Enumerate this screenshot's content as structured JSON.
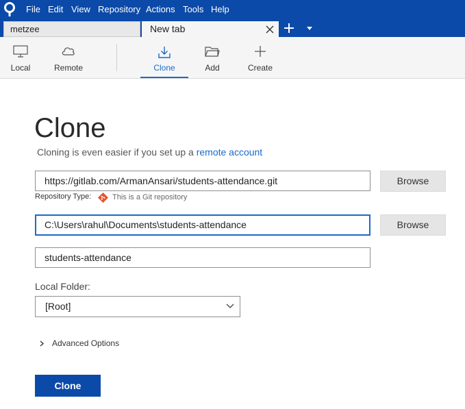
{
  "menu": {
    "items": [
      "File",
      "Edit",
      "View",
      "Repository",
      "Actions",
      "Tools",
      "Help"
    ]
  },
  "tabs": [
    {
      "label": "metzee",
      "active": false
    },
    {
      "label": "New tab",
      "active": true
    }
  ],
  "toolbar": {
    "local": "Local",
    "remote": "Remote",
    "clone": "Clone",
    "add": "Add",
    "create": "Create"
  },
  "clone_page": {
    "title": "Clone",
    "subtitle_prefix": "Cloning is even easier if you set up a ",
    "subtitle_link": "remote account",
    "source_url": "https://gitlab.com/ArmanAnsari/students-attendance.git",
    "repo_type_label": "Repository Type:",
    "repo_type_value": "This is a Git repository",
    "destination_path": "C:\\Users\\rahul\\Documents\\students-attendance",
    "name": "students-attendance",
    "browse_label": "Browse",
    "local_folder_label": "Local Folder:",
    "local_folder_value": "[Root]",
    "advanced_options": "Advanced Options",
    "clone_button": "Clone"
  },
  "colors": {
    "brand": "#0b4aa8",
    "accent": "#1b6ac9",
    "git": "#e4532d"
  }
}
